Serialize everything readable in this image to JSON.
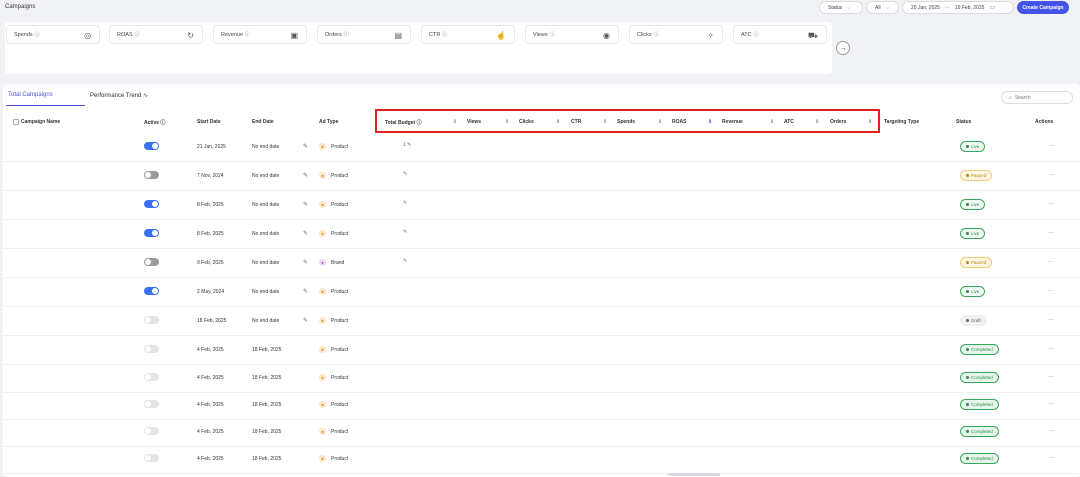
{
  "header": {
    "title": "Campaigns",
    "status_filter": "Status",
    "all_filter": "All",
    "date_from": "20 Jan, 2025",
    "date_sep": "—",
    "date_to": "19 Feb, 2025",
    "create_label": "Create Campaign"
  },
  "metrics": [
    {
      "label": "Spends",
      "icon": "coins-icon"
    },
    {
      "label": "ROAS",
      "icon": "gauge-icon"
    },
    {
      "label": "Revenue",
      "icon": "cash-icon"
    },
    {
      "label": "Orders",
      "icon": "clipboard-icon"
    },
    {
      "label": "CTR",
      "icon": "hand-pointer-icon"
    },
    {
      "label": "Views",
      "icon": "eye-icon"
    },
    {
      "label": "Clicks",
      "icon": "cursor-click-icon"
    },
    {
      "label": "ATC",
      "icon": "cart-icon"
    }
  ],
  "tabs": {
    "total": "Total Campaigns",
    "performance": "Performance Trend"
  },
  "search": {
    "placeholder": "Search"
  },
  "columns": {
    "campaign_name": "Campaign Name",
    "active": "Active",
    "start_date": "Start Date",
    "end_date": "End Date",
    "ad_type": "Ad Type",
    "total_budget": "Total Budget",
    "views": "Views",
    "clicks": "Clicks",
    "ctr": "CTR",
    "spends": "Spends",
    "roas": "ROAS",
    "revenue": "Revenue",
    "atc": "ATC",
    "orders": "Orders",
    "targeting_type": "Targeting Type",
    "status": "Status",
    "actions": "Actions"
  },
  "rows": [
    {
      "active": "on",
      "start": "21 Jan, 2025",
      "end": "No end date",
      "ad_type": "Product",
      "budget": "1 ✎",
      "status": "Live",
      "status_kind": "live"
    },
    {
      "active": "off",
      "start": "7 Nov, 2024",
      "end": "No end date",
      "ad_type": "Product",
      "budget": "✎",
      "status": "Paused",
      "status_kind": "paused"
    },
    {
      "active": "on",
      "start": "8 Feb, 2025",
      "end": "No end date",
      "ad_type": "Product",
      "budget": "✎",
      "status": "Live",
      "status_kind": "live"
    },
    {
      "active": "on",
      "start": "8 Feb, 2025",
      "end": "No end date",
      "ad_type": "Product",
      "budget": "✎",
      "status": "Live",
      "status_kind": "live"
    },
    {
      "active": "off",
      "start": "9 Feb, 2025",
      "end": "No end date",
      "ad_type": "Brand",
      "budget": "✎",
      "status": "Paused",
      "status_kind": "paused"
    },
    {
      "active": "on",
      "start": "2 May, 2024",
      "end": "No end date",
      "ad_type": "Product",
      "budget": "",
      "status": "Live",
      "status_kind": "live"
    },
    {
      "active": "dis",
      "start": "18 Feb, 2025",
      "end": "No end date",
      "ad_type": "Product",
      "budget": "",
      "status": "Draft",
      "status_kind": "draft"
    },
    {
      "active": "dis",
      "start": "4 Feb, 2025",
      "end": "18 Feb, 2025",
      "ad_type": "Product",
      "budget": "",
      "status": "Completed",
      "status_kind": "completed"
    },
    {
      "active": "dis",
      "start": "4 Feb, 2025",
      "end": "18 Feb, 2025",
      "ad_type": "Product",
      "budget": "",
      "status": "Completed",
      "status_kind": "completed"
    },
    {
      "active": "dis",
      "start": "4 Feb, 2025",
      "end": "18 Feb, 2025",
      "ad_type": "Product",
      "budget": "",
      "status": "Completed",
      "status_kind": "completed"
    },
    {
      "active": "dis",
      "start": "4 Feb, 2025",
      "end": "18 Feb, 2025",
      "ad_type": "Product",
      "budget": "",
      "status": "Completed",
      "status_kind": "completed"
    },
    {
      "active": "dis",
      "start": "4 Feb, 2025",
      "end": "18 Feb, 2025",
      "ad_type": "Product",
      "budget": "",
      "status": "Completed",
      "status_kind": "completed"
    }
  ],
  "colors": {
    "accent": "#4453e8",
    "highlight": "#e02020",
    "live": "#2f8a4d",
    "paused": "#b8860b"
  }
}
